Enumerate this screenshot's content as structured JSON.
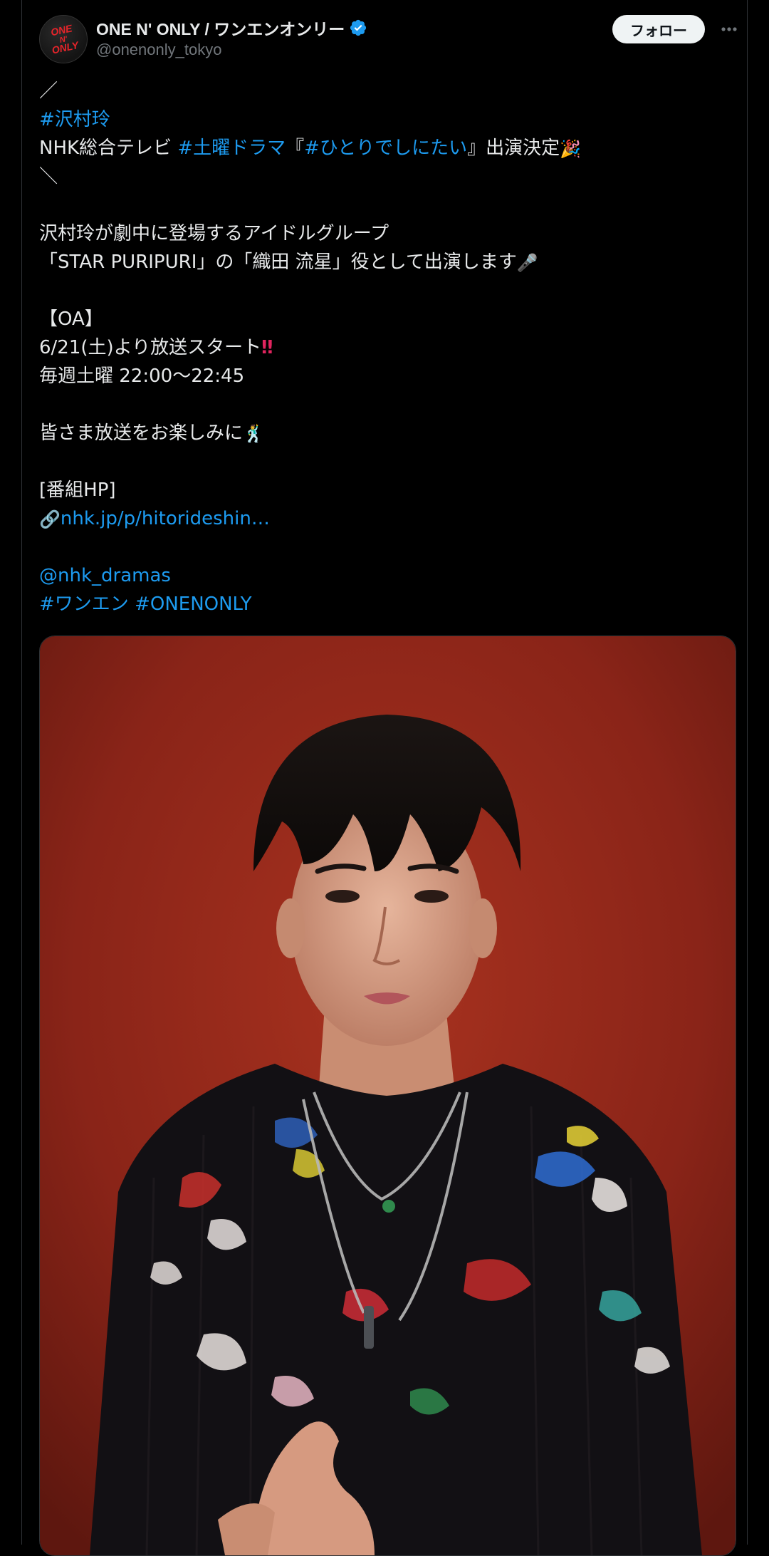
{
  "author": {
    "display_name": "ONE N' ONLY / ワンエンオンリー",
    "handle": "@onenonly_tokyo",
    "avatar_text": [
      "ONE",
      "N'",
      "ONLY"
    ],
    "verified": true
  },
  "actions": {
    "follow_label": "フォロー",
    "more_icon": "more-horizontal-icon"
  },
  "tweet": {
    "deco_open": "／",
    "hashtag_name": "#沢村玲",
    "line2_prefix": "NHK総合テレビ ",
    "line2_tag1": "#土曜ドラマ",
    "line2_bracket_open": "『",
    "line2_tag2": "#ひとりでしにたい",
    "line2_bracket_close": "』",
    "line2_suffix": "出演決定",
    "line2_emoji": "🎉",
    "deco_close": "＼",
    "para1_line1": "沢村玲が劇中に登場するアイドルグループ",
    "para1_line2": "「STAR PURIPURI」の「織田 流星」役として出演します",
    "para1_emoji": "🎤",
    "oa_heading": "【OA】",
    "oa_start": "6/21(土)より放送スタート",
    "oa_start_mark": "‼",
    "oa_time": "毎週土曜 22:00〜22:45",
    "closing": "皆さま放送をお楽しみに",
    "closing_emoji": "🕺",
    "hp_label": "[番組HP]",
    "hp_link_icon": "🔗",
    "hp_link": "nhk.jp/p/hitorideshin…",
    "mention": "@nhk_dramas",
    "tag_a": "#ワンエン",
    "tag_b": "#ONENONLY"
  },
  "colors": {
    "background": "#000000",
    "text": "#e7e9ea",
    "secondary_text": "#71767b",
    "link": "#1d9bf0",
    "verified": "#1d9bf0",
    "photo_background": "#8a2418"
  }
}
